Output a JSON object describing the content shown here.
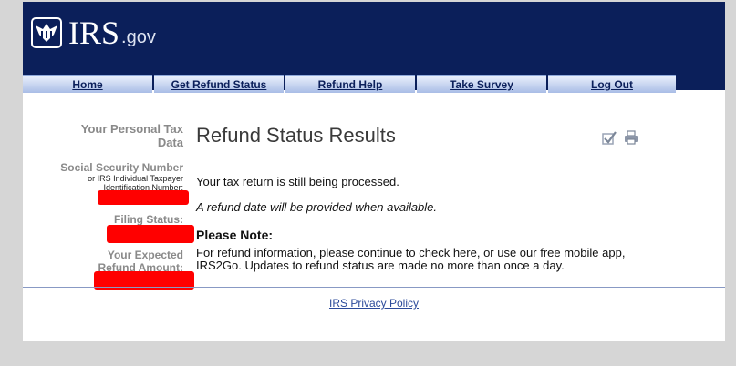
{
  "brand": {
    "logo_main": "IRS",
    "logo_suffix": ".gov"
  },
  "nav": {
    "tabs": [
      "Home",
      "Get Refund Status",
      "Refund Help",
      "Take Survey",
      "Log Out"
    ]
  },
  "sidebar": {
    "personal_tax_data": "Your Personal Tax Data",
    "ssn_label": "Social Security Number",
    "ssn_sublabel": "or IRS Individual Taxpayer Identification Number:",
    "filing_status_label": "Filing Status:",
    "refund_amount_label": "Your Expected Refund Amount:"
  },
  "main": {
    "title": "Refund Status Results",
    "message_1": "Your tax return is still being processed.",
    "message_2": "A refund date will be provided when available.",
    "note_heading": "Please Note:",
    "note_text": "For refund information, please continue to check here, or use our free mobile app, IRS2Go. Updates to refund status are made no more than once a day."
  },
  "footer": {
    "privacy_link": "IRS Privacy Policy"
  },
  "icons": {
    "checkmark": "checkmark-icon",
    "print": "print-icon"
  },
  "colors": {
    "header_bg": "#0b1f5a",
    "redaction": "#ff0000",
    "link": "#2b4a9a"
  }
}
